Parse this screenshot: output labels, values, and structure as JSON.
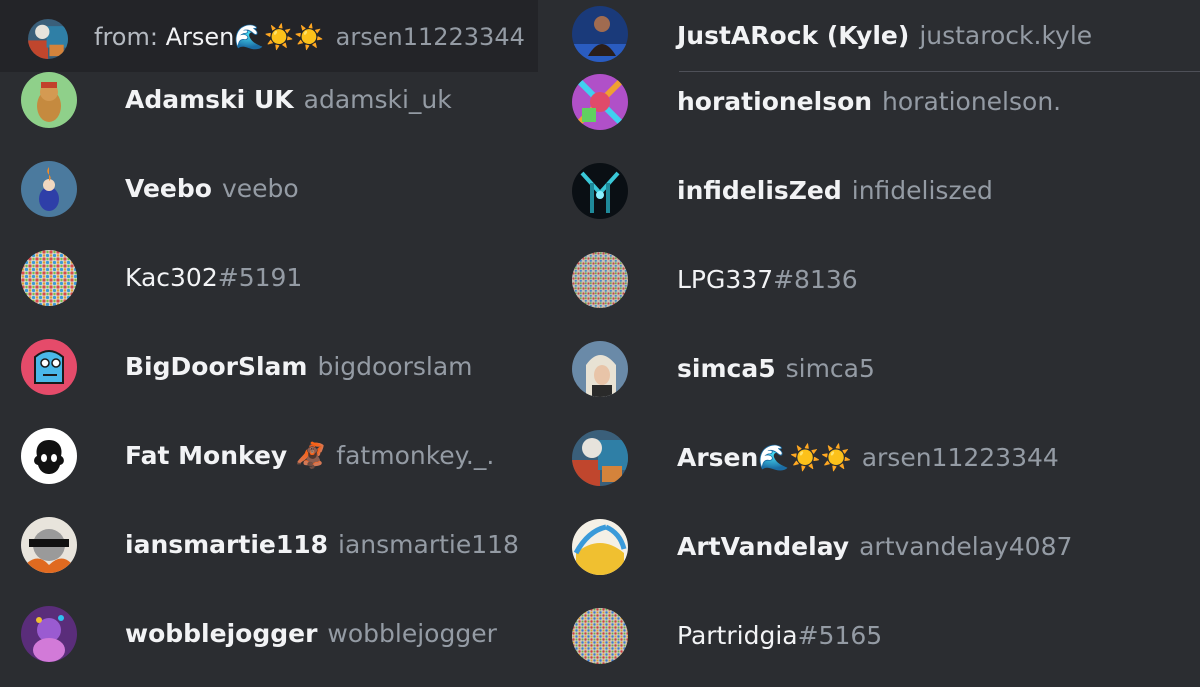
{
  "search": {
    "prefix": "from:",
    "display": "Arsen",
    "emoji": "🌊☀️☀️",
    "username": "arsen11223344"
  },
  "left_members": [
    {
      "display": "Adamski UK",
      "username": "adamski_uk"
    },
    {
      "display": "Veebo",
      "username": "veebo"
    },
    {
      "display": "Kac302",
      "tag": "#5191"
    },
    {
      "display": "BigDoorSlam",
      "username": "bigdoorslam"
    },
    {
      "display": "Fat Monkey",
      "emoji": "🦧",
      "username": "fatmonkey._."
    },
    {
      "display": "iansmartie118",
      "username": "iansmartie118"
    },
    {
      "display": "wobblejogger",
      "username": "wobblejogger"
    }
  ],
  "right_members": [
    {
      "display": "JustARock (Kyle)",
      "username": "justarock.kyle"
    },
    {
      "display": "horationelson",
      "username": "horationelson."
    },
    {
      "display": "infidelisZed",
      "username": "infideliszed"
    },
    {
      "display": "LPG337",
      "tag": "#8136"
    },
    {
      "display": "simca5",
      "username": "simca5"
    },
    {
      "display": "Arsen",
      "emoji": "🌊☀️☀️",
      "username": "arsen11223344"
    },
    {
      "display": "ArtVandelay",
      "username": "artvandelay4087"
    },
    {
      "display": "Partridgia",
      "tag": "#5165"
    }
  ],
  "colors": {
    "background": "#2b2d31",
    "search_background": "#232428",
    "display_name": "#f2f3f5",
    "username": "#949ba4"
  }
}
